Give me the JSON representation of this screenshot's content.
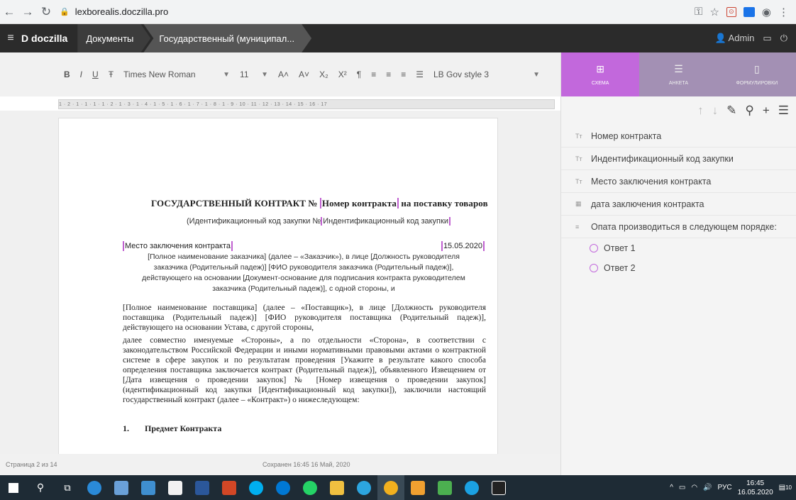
{
  "browser": {
    "url": "lexborealis.doczilla.pro"
  },
  "app": {
    "logo": "D doczilla",
    "breadcrumbs": [
      "Документы",
      "Государственный (муниципал..."
    ],
    "user": "Admin"
  },
  "toolbar": {
    "bold": "B",
    "italic": "I",
    "underline": "U",
    "strike": "Ŧ",
    "font": "Times New Roman",
    "size": "11",
    "style": "LB Gov style 3"
  },
  "ruler_text": "1 · 2 · 1 · 1 · 1 · 1 · 2 · 1 · 3 · 1 · 4 · 1 · 5 · 1 · 6 · 1 · 7 · 1 · 8 · 1 · 9 · 10 · 11 · 12 · 13 · 14 · 15 · 16 · 17",
  "document": {
    "title_prefix": "ГОСУДАРСТВЕННЫЙ КОНТРАКТ №",
    "title_field": "Номер контракта",
    "title_suffix": "на поставку товаров",
    "subtitle_prefix": "(Идентификационный код закупки №",
    "subtitle_field": "Индентификационный код закупки",
    "place": "Место заключения контракта",
    "date": "15.05.2020",
    "para_customer": "[Полное наименование заказчика] (далее – «Заказчик»), в лице [Должность руководителя заказчика (Родительный падеж)] [ФИО руководителя заказчика (Родительный падеж)], действующего на основании [Документ-основание для подписания контракта руководителем заказчика (Родительный падеж)], с одной стороны, и",
    "para_supplier": "[Полное наименование поставщика] (далее – «Поставщик»), в лице [Должность руководителя поставщика (Родительный падеж)] [ФИО руководителя поставщика (Родительный падеж)], действующего на основании Устава, с другой стороны,",
    "para_parties": "далее совместно именуемые «Стороны», а по отдельности «Сторона», в соответствии с законодательством Российской Федерации и иными нормативными правовыми актами о контрактной системе в сфере закупок и по результатам проведения [Укажите в результате какого способа определения поставщика заключается контракт (Родительный падеж)], объявленного Извещением от [Дата извещения о проведении закупок] № [Номер извещения о проведении закупок] (идентификационный код закупки [Идентификационный код закупки]), заключили настоящий государственный контракт (далее – «Контракт») о нижеследующем:",
    "section_num": "1.",
    "section_title": "Предмет Контракта"
  },
  "status": {
    "page": "Страница 2 из 14",
    "saved": "Сохранен 16:45 16 Май, 2020"
  },
  "panel": {
    "tabs": [
      "СХЕМА",
      "АНКЕТА",
      "ФОРМУЛИРОВКИ"
    ],
    "items": [
      {
        "icon": "text-field-icon",
        "label": "Номер контракта"
      },
      {
        "icon": "text-field-icon",
        "label": "Индентификационный код закупки"
      },
      {
        "icon": "text-field-icon",
        "label": "Место заключения контракта"
      },
      {
        "icon": "calendar-icon",
        "label": "дата заключения контракта"
      },
      {
        "icon": "choice-icon",
        "label": "Опата производиться в следующем порядке:"
      }
    ],
    "answers": [
      "Ответ 1",
      "Ответ 2"
    ]
  },
  "taskbar": {
    "lang": "РУС",
    "time": "16:45",
    "date": "16.05.2020",
    "notif": "10"
  },
  "colors": {
    "accent": "#c268dc",
    "appbar": "#2b2b2b",
    "taskbar": "#1e2b35"
  }
}
